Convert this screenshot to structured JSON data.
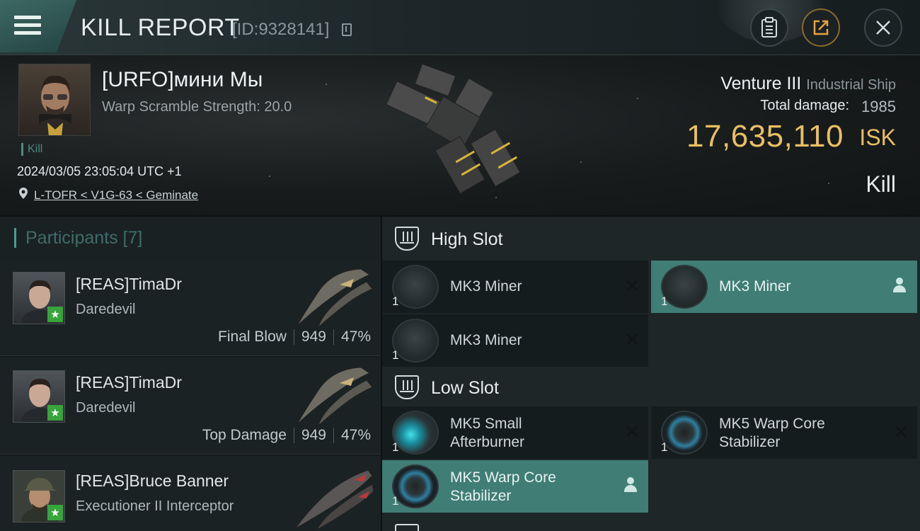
{
  "header": {
    "title": "KILL REPORT",
    "report_id": "[ID:9328141]"
  },
  "victim": {
    "name": "[URFO]мини Мы",
    "warp_scramble": "Warp Scramble Strength: 20.0",
    "kill_tag": "Kill",
    "datetime": "2024/03/05 23:05:04 UTC +1",
    "location": "L-TOFR < V1G-63 < Geminate",
    "ship_name": "Venture III",
    "ship_class": "Industrial Ship",
    "damage_label": "Total damage:",
    "damage_value": "1985",
    "isk_value": "17,635,110",
    "isk_unit": "ISK",
    "result": "Kill"
  },
  "participants": {
    "title": "Participants [7]",
    "rows": [
      {
        "name": "[REAS]TimaDr",
        "ship": "Daredevil",
        "label": "Final Blow",
        "damage": "949",
        "percent": "47%"
      },
      {
        "name": "[REAS]TimaDr",
        "ship": "Daredevil",
        "label": "Top Damage",
        "damage": "949",
        "percent": "47%"
      },
      {
        "name": "[REAS]Bruce Banner",
        "ship": "Executioner II Interceptor",
        "label": "",
        "damage": "",
        "percent": ""
      }
    ]
  },
  "fitting": {
    "high_slot": {
      "title": "High Slot",
      "modules": [
        {
          "name": "MK3 Miner",
          "qty": "1",
          "state": "destroyed"
        },
        {
          "name": "MK3 Miner",
          "qty": "1",
          "state": "dropped"
        },
        {
          "name": "MK3 Miner",
          "qty": "1",
          "state": "destroyed"
        }
      ]
    },
    "low_slot": {
      "title": "Low Slot",
      "modules": [
        {
          "name_line1": "MK5 Small",
          "name_line2": "Afterburner",
          "qty": "1",
          "state": "destroyed"
        },
        {
          "name_line1": "MK5 Warp Core",
          "name_line2": "Stabilizer",
          "qty": "1",
          "state": "destroyed"
        },
        {
          "name_line1": "MK5 Warp Core",
          "name_line2": "Stabilizer",
          "qty": "1",
          "state": "dropped"
        }
      ]
    }
  },
  "colors": {
    "accent_teal": "#3f7d75",
    "isk_gold": "#e9bf62",
    "corp_star_green": "#38a43c"
  }
}
